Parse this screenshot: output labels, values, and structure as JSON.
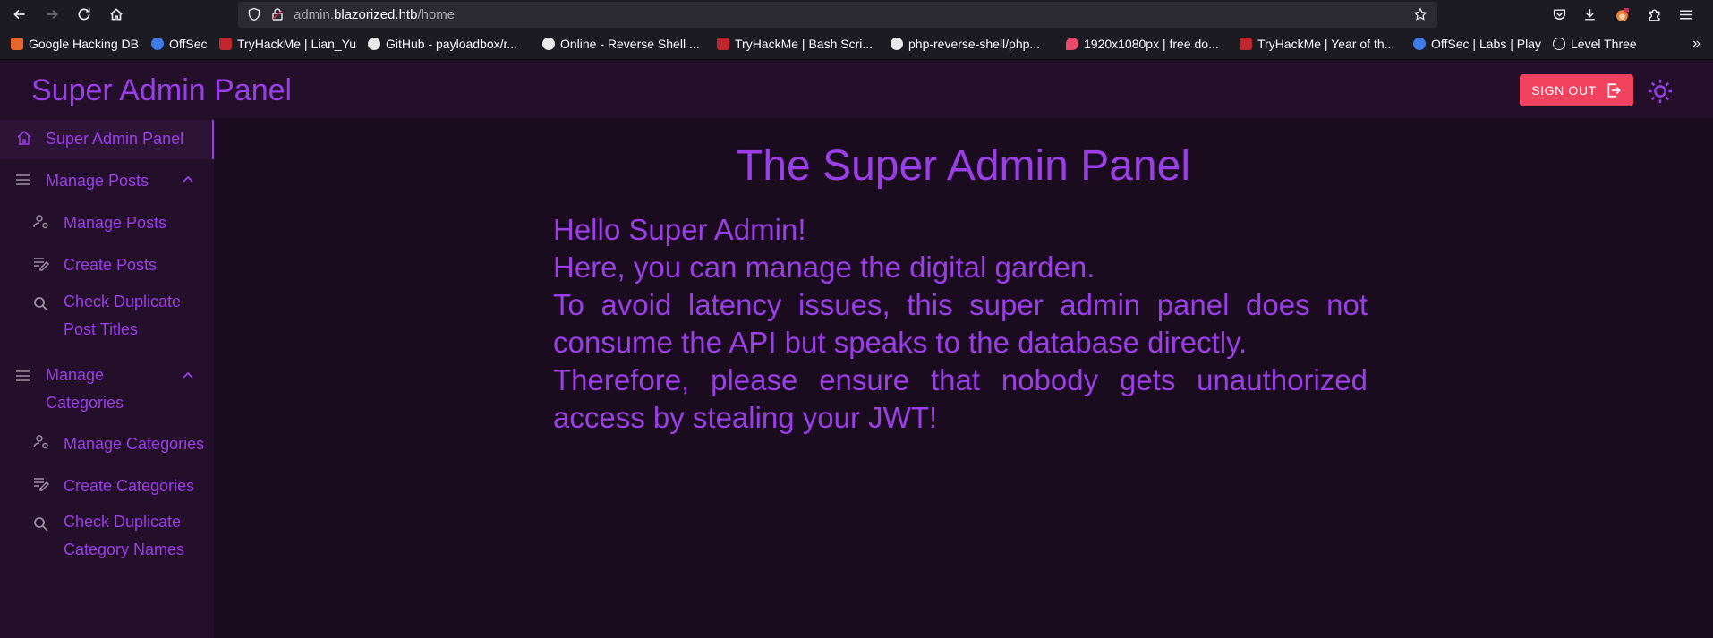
{
  "browser": {
    "url_host_prefix": "admin.",
    "url_host_main": "blazorized.htb",
    "url_path": "/home",
    "bookmarks": [
      {
        "label": "Google Hacking DB",
        "color": "#e8652b"
      },
      {
        "label": "OffSec",
        "color": "#3d7be8"
      },
      {
        "label": "TryHackMe | Lian_Yu",
        "color": "#c0262d"
      },
      {
        "label": "GitHub - payloadbox/r...",
        "color": "#e8e8ea"
      },
      {
        "label": "Online - Reverse Shell ...",
        "color": "#e8e8ea"
      },
      {
        "label": "TryHackMe | Bash Scri...",
        "color": "#c0262d"
      },
      {
        "label": "php-reverse-shell/php...",
        "color": "#e8e8ea"
      },
      {
        "label": "1920x1080px | free do...",
        "color": "#e84b6b"
      },
      {
        "label": "TryHackMe | Year of th...",
        "color": "#c0262d"
      },
      {
        "label": "OffSec | Labs | Play",
        "color": "#3d7be8"
      },
      {
        "label": "Level Three",
        "color": "#e8e8ea"
      }
    ]
  },
  "header": {
    "title": "Super Admin Panel",
    "signout_label": "SIGN OUT"
  },
  "sidebar": {
    "items": [
      {
        "label": "Super Admin Panel",
        "icon": "home-icon"
      },
      {
        "label": "Manage Posts",
        "icon": "menu-icon"
      },
      {
        "label": "Manage Posts",
        "icon": "user-gear-icon"
      },
      {
        "label": "Create Posts",
        "icon": "edit-list-icon"
      },
      {
        "label_line1": "Check Duplicate",
        "label_line2": "Post Titles",
        "icon": "search-icon"
      },
      {
        "label_line1": "Manage",
        "label_line2": "Categories",
        "icon": "menu-icon"
      },
      {
        "label": "Manage Categories",
        "icon": "user-gear-icon"
      },
      {
        "label": "Create Categories",
        "icon": "edit-list-icon"
      },
      {
        "label_line1": "Check Duplicate",
        "label_line2": "Category Names",
        "icon": "search-icon"
      }
    ]
  },
  "main": {
    "title": "The Super Admin Panel",
    "line1": "Hello Super Admin!",
    "line2": "Here, you can manage the digital garden.",
    "line3": "To avoid latency issues, this super admin panel does not consume the API but speaks to the database directly.",
    "line4": "Therefore, please ensure that nobody gets unauthorized access by stealing your JWT!"
  },
  "colors": {
    "accent": "#9a3ee6",
    "signout": "#f0425e",
    "sidebar_bg": "#240f2b",
    "main_bg": "#1a0b1e"
  }
}
